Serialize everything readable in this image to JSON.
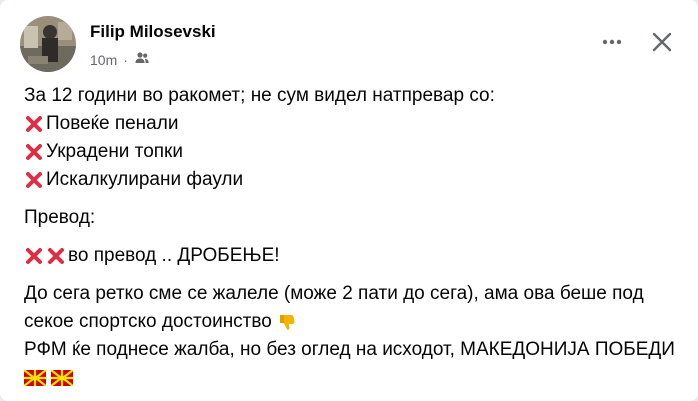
{
  "post": {
    "author": "Filip Milosevski",
    "time": "10m",
    "audience_icon": "friends-icon",
    "more_icon": "more-horizontal-icon",
    "close_icon": "close-icon",
    "lines": {
      "intro": "За 12 години во ракомет; не сум видел натпревар со:",
      "item1": "Повеќе пенали",
      "item2": "Украдени топки",
      "item3": "Искалкулирани фаули",
      "translation_label": "Превод:",
      "translation": "во превод .. ДРОБЕЊЕ!",
      "p1": "До сега ретко сме се жалеле (може 2 пати до сега), ама ова беше под секое спортско достоинство",
      "p2": "РФМ ќе поднесе жалба, но без оглед на исходот, МАКЕДОНИЈА ПОБЕДИ"
    },
    "colors": {
      "cross": "#dd2e44",
      "text": "#050505",
      "secondary": "#65676b",
      "thumb": "#f4b400",
      "flag_red": "#d20000",
      "flag_yellow": "#ffe600"
    }
  }
}
